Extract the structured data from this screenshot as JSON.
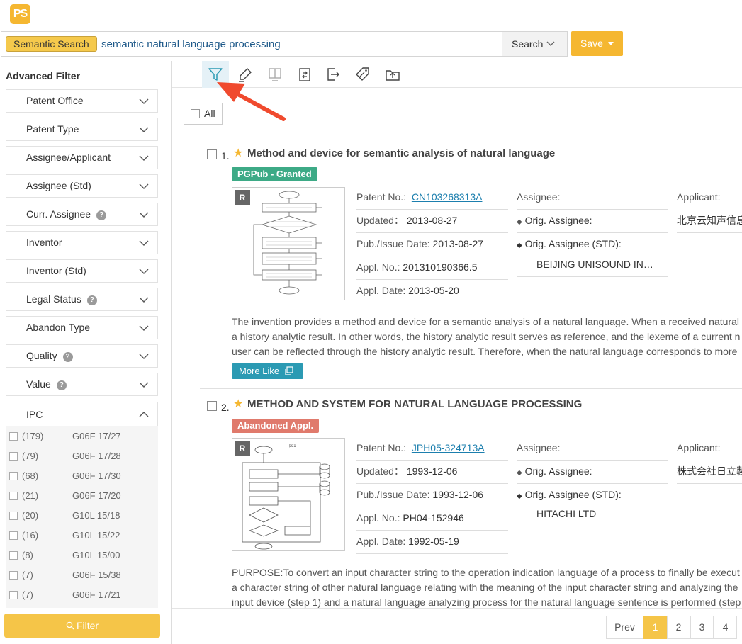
{
  "app": {
    "logo_text": "PS"
  },
  "search": {
    "mode_tag": "Semantic Search",
    "query": "semantic natural language processing",
    "search_label": "Search",
    "save_label": "Save"
  },
  "sidebar": {
    "title": "Advanced Filter",
    "filters": [
      {
        "label": "Patent Office",
        "help": false
      },
      {
        "label": "Patent Type",
        "help": false
      },
      {
        "label": "Assignee/Applicant",
        "help": false
      },
      {
        "label": "Assignee (Std)",
        "help": false
      },
      {
        "label": "Curr. Assignee",
        "help": true
      },
      {
        "label": "Inventor",
        "help": false
      },
      {
        "label": "Inventor (Std)",
        "help": false
      },
      {
        "label": "Legal Status",
        "help": true
      },
      {
        "label": "Abandon Type",
        "help": false
      },
      {
        "label": "Quality",
        "help": true
      },
      {
        "label": "Value",
        "help": true
      }
    ],
    "help_glyph": "?",
    "ipc": {
      "label": "IPC",
      "items": [
        {
          "count": "(179)",
          "code": "G06F 17/27"
        },
        {
          "count": "(79)",
          "code": "G06F 17/28"
        },
        {
          "count": "(68)",
          "code": "G06F 17/30"
        },
        {
          "count": "(21)",
          "code": "G06F 17/20"
        },
        {
          "count": "(20)",
          "code": "G10L 15/18"
        },
        {
          "count": "(16)",
          "code": "G10L 15/22"
        },
        {
          "count": "(8)",
          "code": "G10L 15/00"
        },
        {
          "count": "(7)",
          "code": "G06F 15/38"
        },
        {
          "count": "(7)",
          "code": "G06F 17/21"
        }
      ]
    },
    "filter_button": "Filter"
  },
  "toolbar": {
    "icons": [
      "filter-icon",
      "highlight-icon",
      "split-view-icon",
      "compare-icon",
      "export-icon",
      "tag-icon",
      "save-to-folder-icon"
    ]
  },
  "select_all_label": "All",
  "results": [
    {
      "number": "1.",
      "title": "Method and device for semantic analysis of natural language",
      "status": "PGPub - Granted",
      "badge": "R",
      "patent_no_label": "Patent No.:",
      "patent_no": "CN103268313A",
      "updated_label": "Updated：",
      "updated": "2013-08-27",
      "pub_label": "Pub./Issue Date:",
      "pub": "2013-08-27",
      "appl_no_label": "Appl. No.:",
      "appl_no": "201310190366.5",
      "appl_date_label": "Appl. Date:",
      "appl_date": "2013-05-20",
      "assignee_label": "Assignee:",
      "orig_assignee_label": "Orig. Assignee:",
      "orig_assignee_std_label": "Orig. Assignee (STD):",
      "orig_assignee_std": "BEIJING UNISOUND IN…",
      "applicant_label": "Applicant:",
      "applicant": "北京云知声信息技术有限公司",
      "abstract": [
        "The invention provides a method and device for a semantic analysis of a natural language. When a received natural",
        "a history analytic result. In other words, the history analytic result serves as reference, and the lexeme of a current n",
        "user can be reflected through the history analytic result. Therefore, when the natural language corresponds to more"
      ],
      "more_like": "More Like"
    },
    {
      "number": "2.",
      "title": "METHOD AND SYSTEM FOR NATURAL LANGUAGE PROCESSING",
      "status": "Abandoned Appl.",
      "badge": "R",
      "patent_no_label": "Patent No.:",
      "patent_no": "JPH05-324713A",
      "updated_label": "Updated：",
      "updated": "1993-12-06",
      "pub_label": "Pub./Issue Date:",
      "pub": "1993-12-06",
      "appl_no_label": "Appl. No.:",
      "appl_no": "PH04-152946",
      "appl_date_label": "Appl. Date:",
      "appl_date": "1992-05-19",
      "assignee_label": "Assignee:",
      "orig_assignee_label": "Orig. Assignee:",
      "orig_assignee_std_label": "Orig. Assignee (STD):",
      "orig_assignee_std": "HITACHI LTD",
      "applicant_label": "Applicant:",
      "applicant": "株式会社日立製作所",
      "abstract": [
        "PURPOSE:To convert an input character string to the operation indication language of a process to finally be execut",
        "a character string of other natural language relating with the meaning of the input character string and analyzing the",
        "input device (step 1) and a natural language analyzing process for the natural language sentence is performed (step"
      ]
    }
  ],
  "pagination": {
    "prev": "Prev",
    "pages": [
      "1",
      "2",
      "3",
      "4"
    ],
    "current": "1"
  },
  "colors": {
    "accent": "#f5b731",
    "link": "#1c7fae",
    "granted": "#3daa86",
    "abandoned": "#e07a6c",
    "pointer_arrow": "#f04a2e"
  }
}
